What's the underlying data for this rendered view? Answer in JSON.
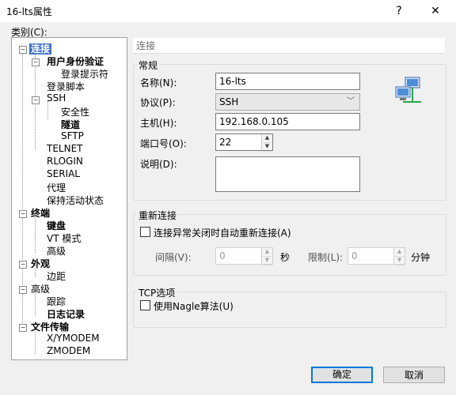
{
  "window": {
    "title": "16-lts属性",
    "help": "?",
    "close": "✕"
  },
  "category_label": "类别(C):",
  "tree": {
    "connection": "连接",
    "auth": "用户身份验证",
    "login_prompt": "登录提示符",
    "login_script": "登录脚本",
    "ssh": "SSH",
    "security": "安全性",
    "tunnel": "隧道",
    "sftp": "SFTP",
    "telnet": "TELNET",
    "rlogin": "RLOGIN",
    "serial": "SERIAL",
    "proxy": "代理",
    "keepalive": "保持活动状态",
    "terminal": "终端",
    "keyboard": "键盘",
    "vt_mode": "VT 模式",
    "terminal_advanced": "高级",
    "appearance": "外观",
    "margin": "边距",
    "advanced": "高级",
    "trace": "跟踪",
    "logging": "日志记录",
    "file_transfer": "文件传输",
    "xymodem": "X/YMODEM",
    "zmodem": "ZMODEM"
  },
  "panel": {
    "title": "连接"
  },
  "general": {
    "label": "常规",
    "name_label": "名称(N):",
    "name_value": "16-lts",
    "protocol_label": "协议(P):",
    "protocol_value": "SSH",
    "host_label": "主机(H):",
    "host_value": "192.168.0.105",
    "port_label": "端口号(O):",
    "port_value": "22",
    "desc_label": "说明(D):",
    "desc_value": ""
  },
  "reconnect": {
    "label": "重新连接",
    "checkbox_label": "连接异常关闭时自动重新连接(A)",
    "interval_label": "间隔(V):",
    "interval_value": "0",
    "interval_unit": "秒",
    "limit_label": "限制(L):",
    "limit_value": "0",
    "limit_unit": "分钟"
  },
  "tcp": {
    "label": "TCP选项",
    "nagle_label": "使用Nagle算法(U)"
  },
  "buttons": {
    "ok": "确定",
    "cancel": "取消"
  },
  "icon": {
    "name": "network-computers-icon"
  }
}
